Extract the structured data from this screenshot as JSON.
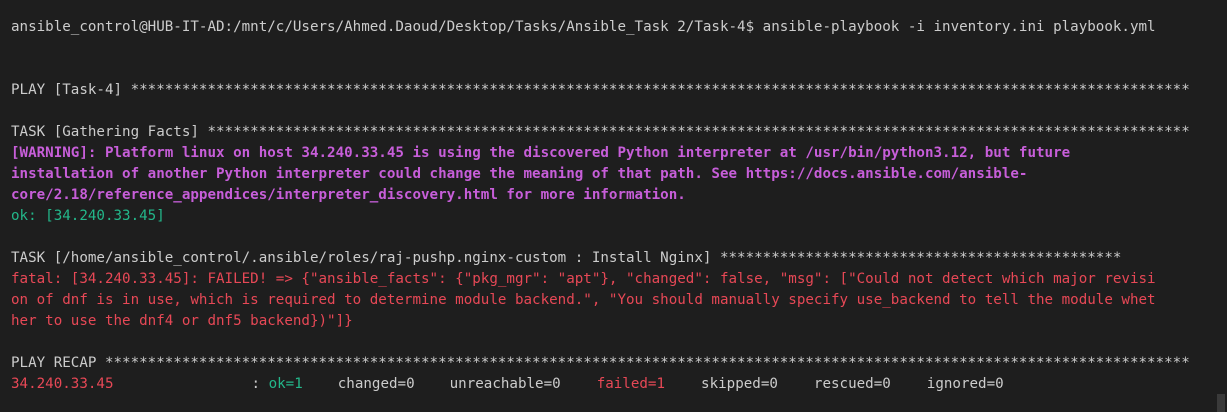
{
  "terminal": {
    "prompt": "ansible_control@HUB-IT-AD:/mnt/c/Users/Ahmed.Daoud/Desktop/Tasks/Ansible_Task 2/Task-4$ ansible-playbook -i inventory.ini playbook.yml",
    "play_header": "PLAY [Task-4] ****************************************************************************************************************************",
    "task_gather_header": "TASK [Gathering Facts] *******************************************************************************************************************",
    "warning_line1": "[WARNING]: Platform linux on host 34.240.33.45 is using the discovered Python interpreter at /usr/bin/python3.12, but future",
    "warning_line2": "installation of another Python interpreter could change the meaning of that path. See https://docs.ansible.com/ansible-",
    "warning_line3": "core/2.18/reference_appendices/interpreter_discovery.html for more information.",
    "ok_line": "ok: [34.240.33.45]",
    "task_nginx_header": "TASK [/home/ansible_control/.ansible/roles/raj-pushp.nginx-custom : Install Nginx] ***********************************************",
    "fatal_line1": "fatal: [34.240.33.45]: FAILED! => {\"ansible_facts\": {\"pkg_mgr\": \"apt\"}, \"changed\": false, \"msg\": [\"Could not detect which major revisi",
    "fatal_line2": "on of dnf is in use, which is required to determine module backend.\", \"You should manually specify use_backend to tell the module whet",
    "fatal_line3": "her to use the dnf4 or dnf5 backend})\"]}",
    "recap_header": "PLAY RECAP *******************************************************************************************************************************",
    "recap": {
      "host": "34.240.33.45",
      "sep": ": ",
      "ok": "ok=1",
      "changed": "changed=0",
      "unreachable": "unreachable=0",
      "failed": "failed=1",
      "skipped": "skipped=0",
      "rescued": "rescued=0",
      "ignored": "ignored=0"
    }
  },
  "colors": {
    "background": "#1e1e1e",
    "text": "#cccccc",
    "warning": "#c75ed9",
    "ok": "#16c60c",
    "failed": "#e74856"
  }
}
